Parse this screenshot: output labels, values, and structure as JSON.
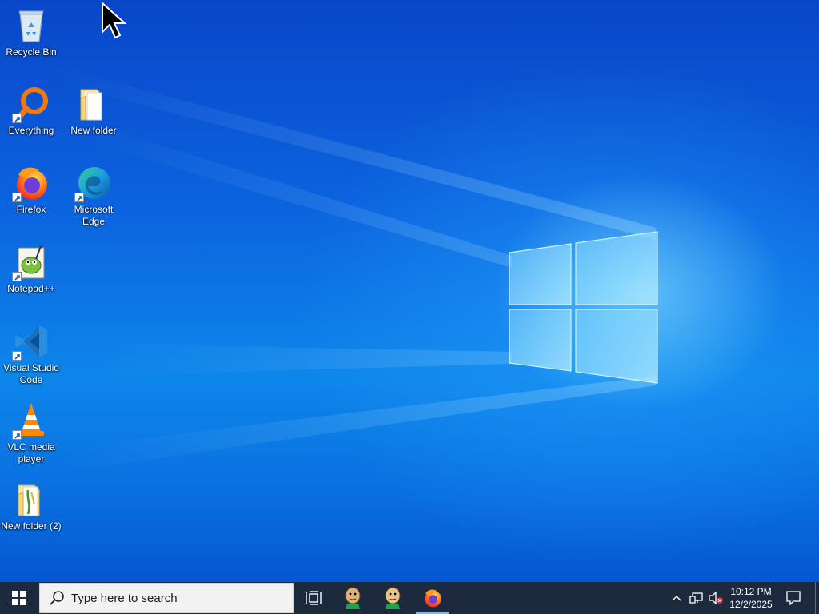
{
  "desktop": {
    "icons": [
      {
        "id": "recycle-bin",
        "label": "Recycle Bin",
        "icon": "recycle-bin-icon"
      },
      {
        "id": "everything",
        "label": "Everything",
        "icon": "magnifier-icon"
      },
      {
        "id": "new-folder",
        "label": "New folder",
        "icon": "folder-icon"
      },
      {
        "id": "firefox",
        "label": "Firefox",
        "icon": "firefox-icon"
      },
      {
        "id": "microsoft-edge",
        "label": "Microsoft Edge",
        "icon": "edge-icon"
      },
      {
        "id": "notepad-plus-plus",
        "label": "Notepad++",
        "icon": "notepad-plus-plus-icon"
      },
      {
        "id": "vscode",
        "label": "Visual Studio Code",
        "icon": "vscode-icon"
      },
      {
        "id": "vlc",
        "label": "VLC media player",
        "icon": "vlc-cone-icon"
      },
      {
        "id": "new-folder-2",
        "label": "New folder (2)",
        "icon": "folder-icon"
      }
    ]
  },
  "taskbar": {
    "search_placeholder": "Type here to search",
    "clock_time": "10:12 PM",
    "clock_date": "12/2/2025",
    "pinned": [
      "task-view-icon",
      "character-app-icon",
      "character-app-icon",
      "firefox-icon"
    ]
  },
  "colors": {
    "taskbar_bg": "#1d2a3e",
    "desktop_blue": "#0b63de",
    "accent": "#7fb7ff"
  }
}
